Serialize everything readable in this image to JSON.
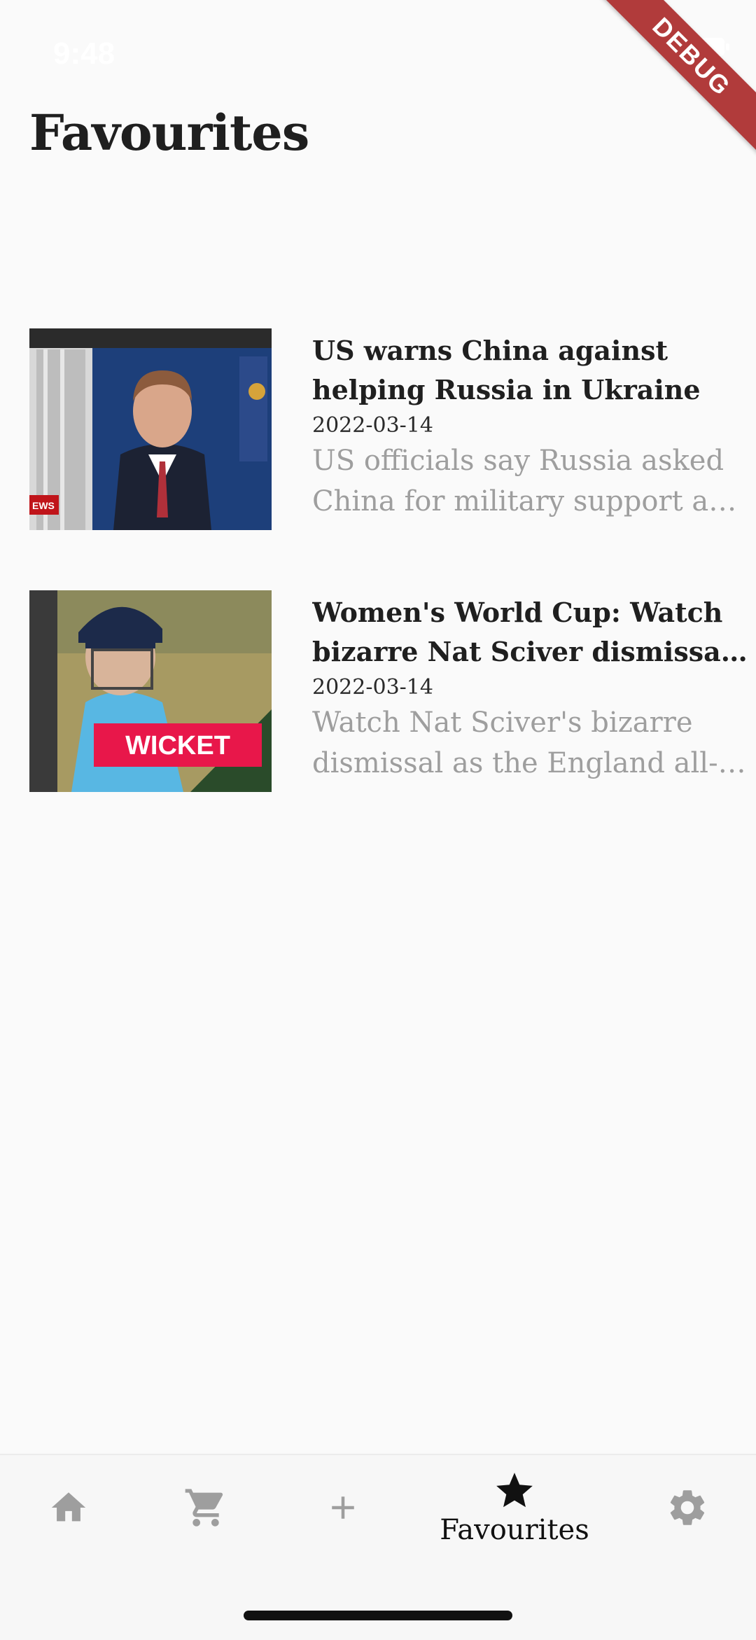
{
  "status_bar": {
    "time": "9:48",
    "debug_label": "DEBUG"
  },
  "page": {
    "title": "Favourites"
  },
  "articles": [
    {
      "title": "US warns China against helping Russia in Ukraine",
      "date": "2022-03-14",
      "description": "US officials say Russia asked China for military support and economic assistance.",
      "thumb_badge": "EWS"
    },
    {
      "title": "Women's World Cup: Watch bizarre Nat Sciver dismissal for England",
      "date": "2022-03-14",
      "description": "Watch Nat Sciver's bizarre dismissal as the England all-rounder is run out.",
      "thumb_badge": "WICKET"
    }
  ],
  "bottom_nav": {
    "items": [
      {
        "icon": "home-icon",
        "label": ""
      },
      {
        "icon": "cart-icon",
        "label": ""
      },
      {
        "icon": "plus-icon",
        "label": ""
      },
      {
        "icon": "star-icon",
        "label": "Favourites",
        "active": true
      },
      {
        "icon": "gear-icon",
        "label": ""
      }
    ]
  },
  "colors": {
    "accent": "#111111",
    "muted_text": "#9e9e9e",
    "debug_ribbon": "#b13b3b"
  }
}
